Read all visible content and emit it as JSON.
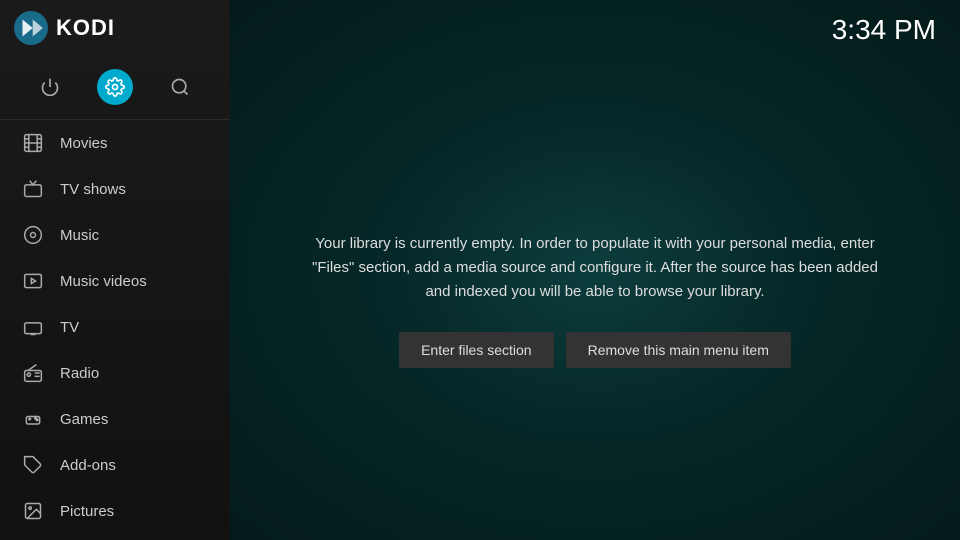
{
  "app": {
    "name": "KODI"
  },
  "clock": {
    "time": "3:34 PM"
  },
  "sidebar": {
    "icons": [
      {
        "id": "power-icon",
        "label": "Power",
        "symbol": "⏻",
        "active": false
      },
      {
        "id": "settings-icon",
        "label": "Settings",
        "symbol": "⚙",
        "active": true
      },
      {
        "id": "search-icon",
        "label": "Search",
        "symbol": "⌕",
        "active": false
      }
    ],
    "nav_items": [
      {
        "id": "movies",
        "label": "Movies",
        "icon": "🎬"
      },
      {
        "id": "tv-shows",
        "label": "TV shows",
        "icon": "📺"
      },
      {
        "id": "music",
        "label": "Music",
        "icon": "🎧"
      },
      {
        "id": "music-videos",
        "label": "Music videos",
        "icon": "🎞"
      },
      {
        "id": "tv",
        "label": "TV",
        "icon": "📡"
      },
      {
        "id": "radio",
        "label": "Radio",
        "icon": "📻"
      },
      {
        "id": "games",
        "label": "Games",
        "icon": "🎮"
      },
      {
        "id": "add-ons",
        "label": "Add-ons",
        "icon": "📦"
      },
      {
        "id": "pictures",
        "label": "Pictures",
        "icon": "🖼"
      }
    ]
  },
  "main": {
    "empty_library_message": "Your library is currently empty. In order to populate it with your personal media, enter \"Files\" section, add a media source and configure it. After the source has been added and indexed you will be able to browse your library.",
    "buttons": [
      {
        "id": "enter-files-btn",
        "label": "Enter files section"
      },
      {
        "id": "remove-menu-item-btn",
        "label": "Remove this main menu item"
      }
    ]
  }
}
